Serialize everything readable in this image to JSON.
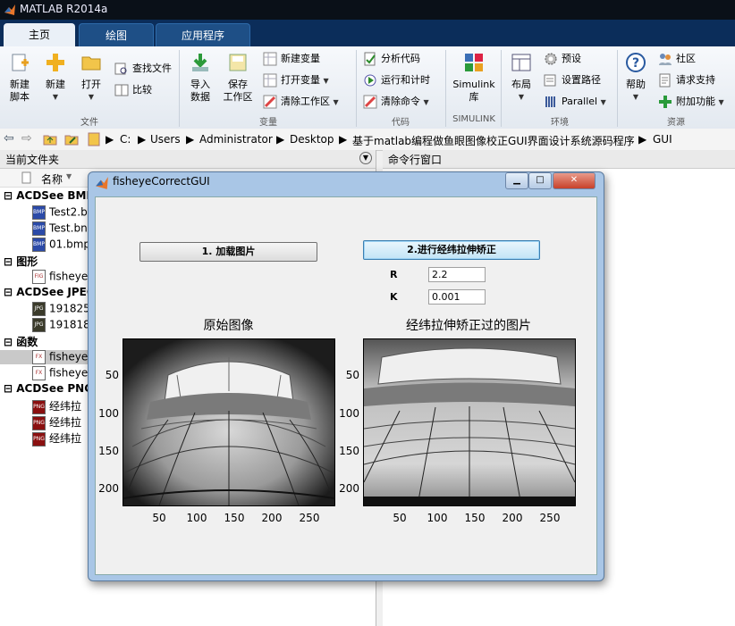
{
  "window": {
    "title": "MATLAB R2014a"
  },
  "tabs": [
    {
      "label": "主页"
    },
    {
      "label": "绘图"
    },
    {
      "label": "应用程序"
    }
  ],
  "ribbon": {
    "file": {
      "new_script": "新建\n脚本",
      "new": "新建",
      "open": "打开",
      "find_files": "查找文件",
      "compare": "比较",
      "group": "文件"
    },
    "variable": {
      "import": "导入\n数据",
      "save_ws": "保存\n工作区",
      "new_var": "新建变量",
      "open_var": "打开变量",
      "clear_ws": "清除工作区",
      "group": "变量"
    },
    "code": {
      "analyze": "分析代码",
      "run_time": "运行和计时",
      "clear_cmd": "清除命令",
      "group": "代码"
    },
    "simulink": {
      "label": "Simulink\n库",
      "group": "SIMULINK"
    },
    "env": {
      "layout": "布局",
      "prefs": "预设",
      "set_path": "设置路径",
      "parallel": "Parallel",
      "group": "环境"
    },
    "resources": {
      "help": "帮助",
      "community": "社区",
      "request_support": "请求支持",
      "addons": "附加功能",
      "group": "资源"
    }
  },
  "address": {
    "crumbs": [
      "C:",
      "Users",
      "Administrator",
      "Desktop",
      "基于matlab编程做鱼眼图像校正GUI界面设计系统源码程序",
      "GUI"
    ]
  },
  "left_panel": {
    "title": "当前文件夹",
    "column": "名称",
    "groups": [
      {
        "label": "ACDSee BMP",
        "items": [
          "Test2.b",
          "Test.bn",
          "01.bmp"
        ],
        "icon": "BMP",
        "color": "#2b4aa8"
      },
      {
        "label": "图形",
        "items": [
          "fisheye"
        ],
        "icon": "FIG",
        "color": "#ffffff"
      },
      {
        "label": "ACDSee JPEG",
        "items": [
          "191825",
          "191818"
        ],
        "icon": "JPG",
        "color": "#3a3a2a"
      },
      {
        "label": "函数",
        "items": [
          "fisheye",
          "fisheye"
        ],
        "icon": "FX",
        "color": "#ffffff"
      },
      {
        "label": "ACDSee PNG",
        "items": [
          "经纬拉",
          "经纬拉",
          "经纬拉"
        ],
        "icon": "PNG",
        "color": "#8a1010"
      }
    ]
  },
  "right_panel": {
    "title": "命令行窗口"
  },
  "figure": {
    "title": "fisheyeCorrectGUI",
    "load_button": "1. 加载图片",
    "correct_button": "2.进行经纬拉伸矫正",
    "r_label": "R",
    "r_value": "2.2",
    "k_label": "K",
    "k_value": "0.001",
    "axes1_title": "原始图像",
    "axes2_title": "经纬拉伸矫正过的图片",
    "yticks": [
      "50",
      "100",
      "150",
      "200"
    ],
    "xticks": [
      "50",
      "100",
      "150",
      "200",
      "250"
    ]
  }
}
